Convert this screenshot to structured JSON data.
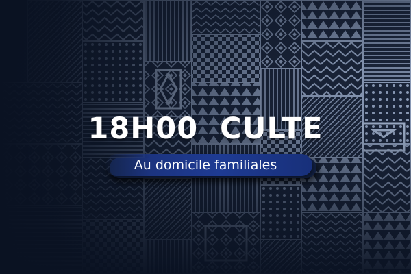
{
  "headline": "18H00  CULTE",
  "subtitle": "Au domicile familiales",
  "colors": {
    "background": "#111a2c",
    "pattern_stroke": "#8a9ab6",
    "pill": "#1e3b93",
    "text": "#ffffff"
  }
}
